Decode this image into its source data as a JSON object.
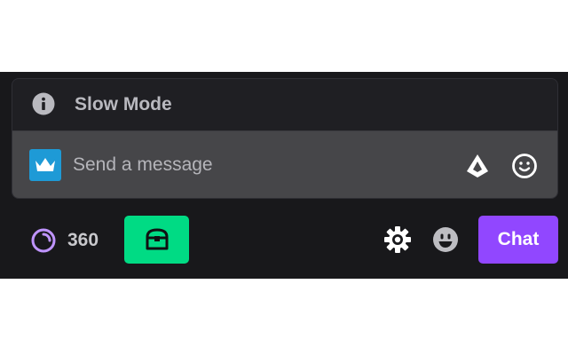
{
  "slow_mode": {
    "icon": "info-icon",
    "label": "Slow Mode"
  },
  "message_input": {
    "badge_icon": "crown-icon",
    "placeholder": "Send a message",
    "value": "",
    "bits_icon": "bits-icon",
    "emote_icon": "smiley-icon"
  },
  "footer": {
    "points": {
      "icon": "channel-points-icon",
      "value": "360"
    },
    "chest_button_icon": "treasure-chest-icon",
    "settings_icon": "gear-icon",
    "emote_icon": "grin-icon",
    "chat_label": "Chat"
  },
  "colors": {
    "panel_background": "#18181b",
    "input_background": "#464649",
    "badge_blue": "#1e9ad6",
    "points_purple": "#bf94ff",
    "chest_green": "#00db84",
    "chat_purple": "#9147ff"
  }
}
